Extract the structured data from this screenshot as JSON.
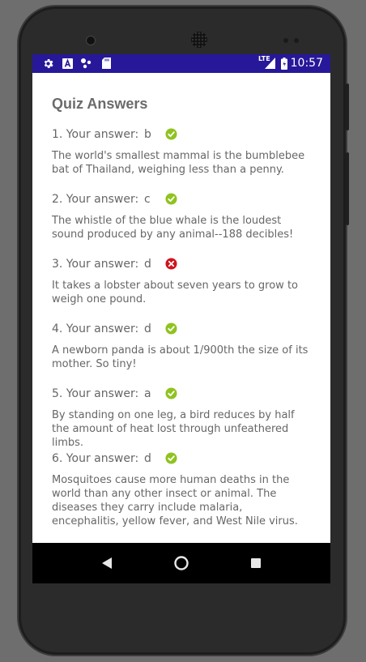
{
  "status_bar": {
    "time": "10:57",
    "network": "LTE",
    "left_icons": [
      "gear-icon",
      "a-icon",
      "dots-icon",
      "sd-card-icon"
    ],
    "right_icons": [
      "signal-icon",
      "battery-icon"
    ]
  },
  "page": {
    "title": "Quiz Answers"
  },
  "answers": [
    {
      "label": "1. Your answer:",
      "answer": "b",
      "correct": true,
      "fact": "The world's smallest mammal is the bumblebee bat of Thailand, weighing less than a penny."
    },
    {
      "label": "2. Your answer:",
      "answer": "c",
      "correct": true,
      "fact": "The whistle of the blue whale is the loudest sound produced by any animal--188 decibles!"
    },
    {
      "label": "3. Your answer:",
      "answer": "d",
      "correct": false,
      "fact": "It takes a lobster about seven years to grow to weigh one pound."
    },
    {
      "label": "4. Your answer:",
      "answer": "d",
      "correct": true,
      "fact": "A newborn panda is about 1/900th the size of its mother. So tiny!"
    },
    {
      "label": "5. Your answer:",
      "answer": "a",
      "correct": true,
      "fact": "By standing on one leg, a bird reduces by half the amount of heat lost through unfeathered limbs."
    },
    {
      "label": "6. Your answer:",
      "answer": "d",
      "correct": true,
      "fact": "Mosquitoes cause more human deaths in the world than any other insect or animal. The diseases they carry include malaria, encephalitis, yellow fever, and West Nile virus."
    }
  ],
  "colors": {
    "status_bar": "#27189a",
    "correct": "#8fc31f",
    "incorrect": "#d0141c",
    "text": "#666666"
  },
  "nav_bar": {
    "icons": [
      "back-icon",
      "home-icon",
      "recents-icon"
    ]
  }
}
